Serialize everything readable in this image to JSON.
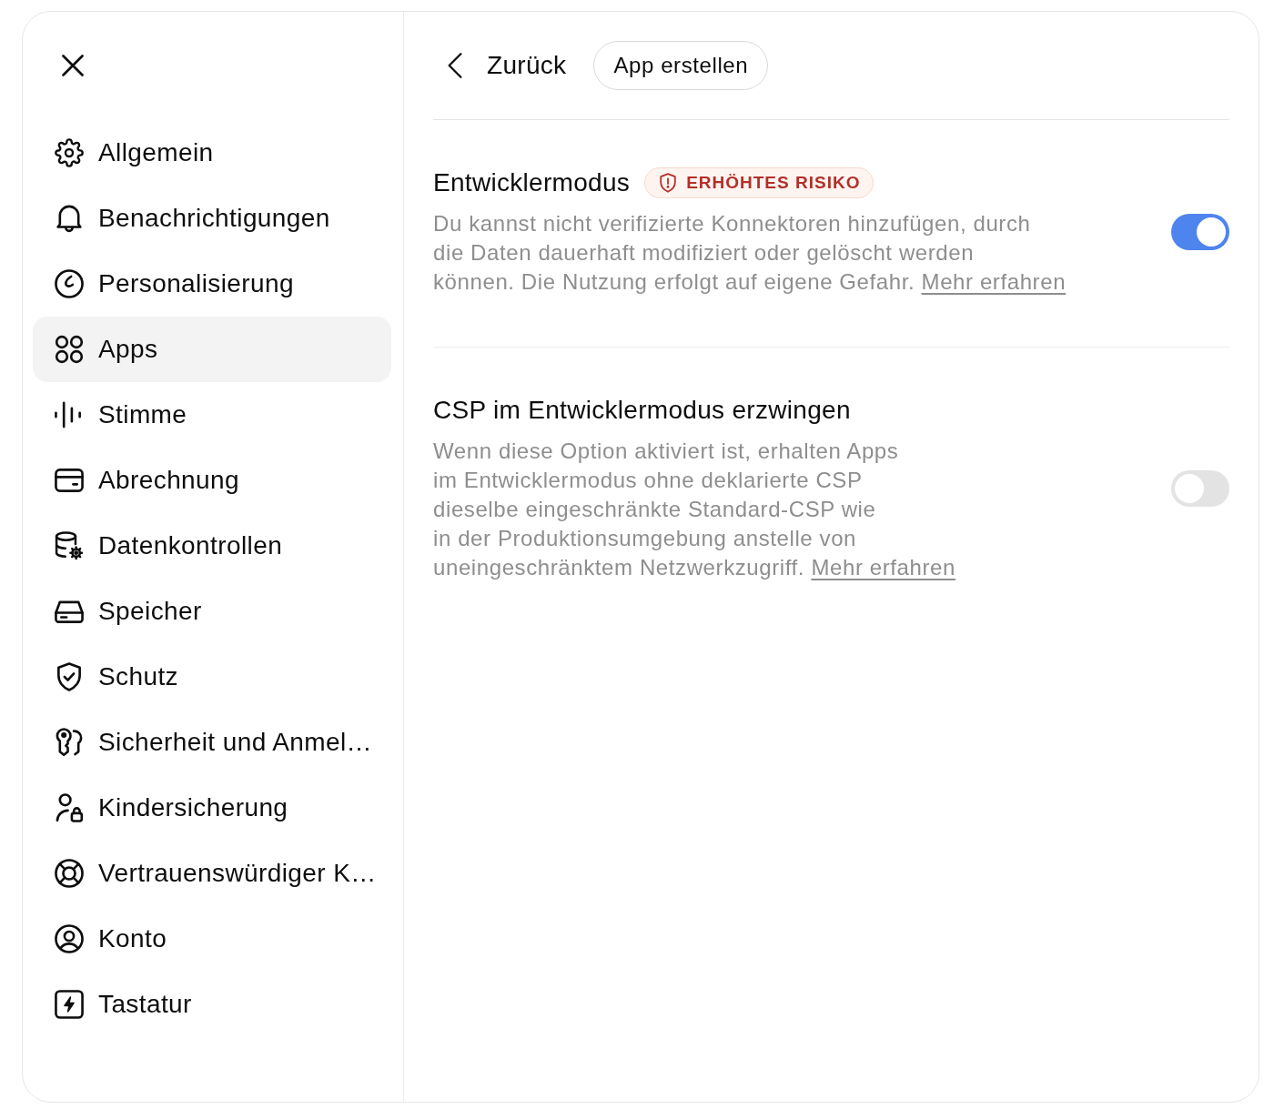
{
  "sidebar": {
    "items": [
      {
        "label": "Allgemein",
        "selected": false
      },
      {
        "label": "Benachrichtigungen",
        "selected": false
      },
      {
        "label": "Personalisierung",
        "selected": false
      },
      {
        "label": "Apps",
        "selected": true
      },
      {
        "label": "Stimme",
        "selected": false
      },
      {
        "label": "Abrechnung",
        "selected": false
      },
      {
        "label": "Datenkontrollen",
        "selected": false
      },
      {
        "label": "Speicher",
        "selected": false
      },
      {
        "label": "Schutz",
        "selected": false
      },
      {
        "label": "Sicherheit und Anmel…",
        "selected": false
      },
      {
        "label": "Kindersicherung",
        "selected": false
      },
      {
        "label": "Vertrauenswürdiger K…",
        "selected": false
      },
      {
        "label": "Konto",
        "selected": false
      },
      {
        "label": "Tastatur",
        "selected": false
      }
    ]
  },
  "header": {
    "back_label": "Zurück",
    "action_button": "App erstellen"
  },
  "settings": [
    {
      "title": "Entwicklermodus",
      "badge": "ERHÖHTES RISIKO",
      "description_lines": [
        "Du kannst nicht verifizierte Konnektoren hinzufügen, durch",
        "die Daten dauerhaft modifiziert oder gelöscht werden",
        "können. Die Nutzung erfolgt auf eigene Gefahr."
      ],
      "link": "Mehr erfahren",
      "on": true
    },
    {
      "title": "CSP im Entwicklermodus erzwingen",
      "description_lines": [
        "Wenn diese Option aktiviert ist, erhalten Apps",
        "im Entwicklermodus ohne deklarierte CSP",
        "dieselbe eingeschränkte Standard-CSP wie",
        "in der Produktionsumgebung anstelle von",
        "uneingeschränktem Netzwerkzugriff."
      ],
      "link": "Mehr erfahren",
      "on": false
    }
  ]
}
